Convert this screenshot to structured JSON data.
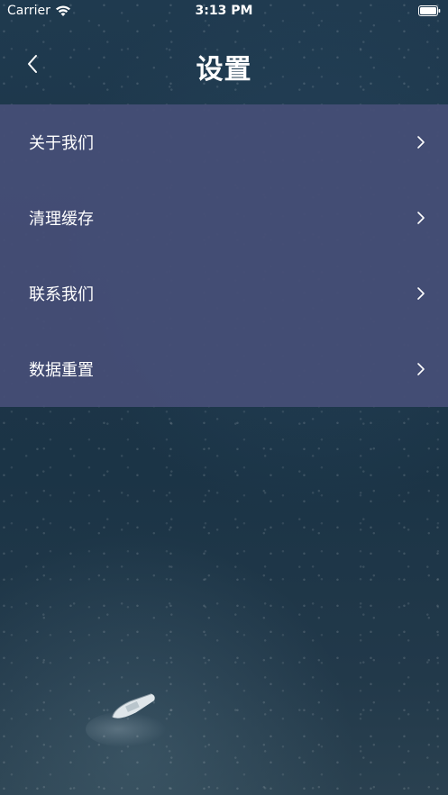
{
  "status_bar": {
    "carrier": "Carrier",
    "time": "3:13 PM"
  },
  "nav": {
    "title": "设置",
    "back_icon": "chevron-left-icon"
  },
  "menu": {
    "items": [
      {
        "label": "关于我们",
        "icon": "chevron-right-icon"
      },
      {
        "label": "清理缓存",
        "icon": "chevron-right-icon"
      },
      {
        "label": "联系我们",
        "icon": "chevron-right-icon"
      },
      {
        "label": "数据重置",
        "icon": "chevron-right-icon"
      }
    ]
  },
  "colors": {
    "menu_background": "#464e76",
    "text": "#ffffff",
    "sea_dark": "#1d3649"
  }
}
